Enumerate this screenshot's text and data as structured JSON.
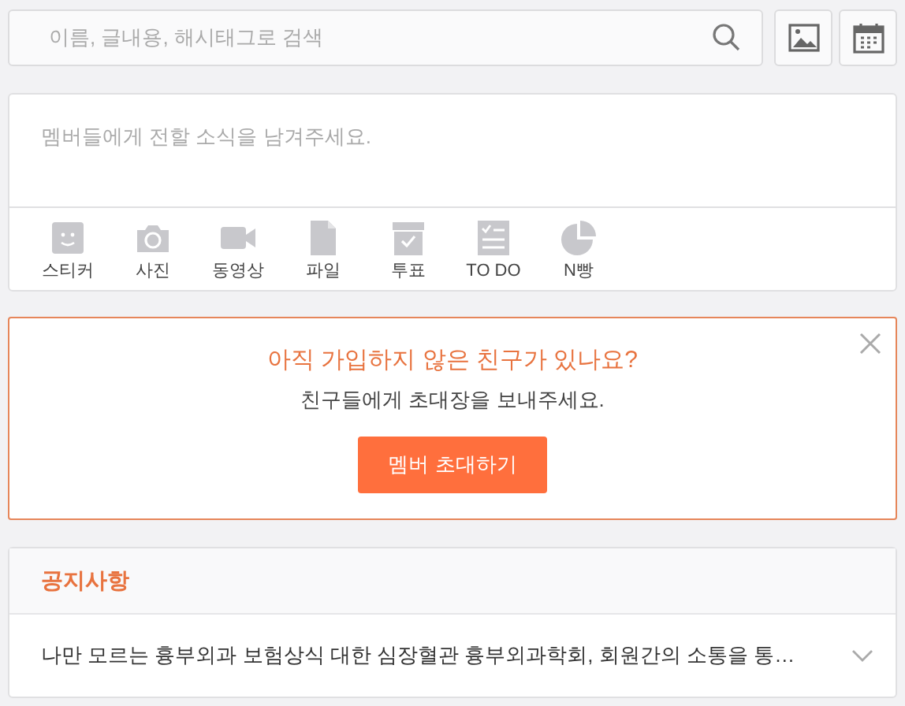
{
  "search": {
    "placeholder": "이름, 글내용, 해시태그로 검색"
  },
  "composer": {
    "placeholder": "멤버들에게 전할 소식을 남겨주세요.",
    "tools": [
      {
        "kind": "sticker",
        "label": "스티커"
      },
      {
        "kind": "photo",
        "label": "사진"
      },
      {
        "kind": "video",
        "label": "동영상"
      },
      {
        "kind": "file",
        "label": "파일"
      },
      {
        "kind": "vote",
        "label": "투표"
      },
      {
        "kind": "todo",
        "label": "TO DO"
      },
      {
        "kind": "split",
        "label": "N빵"
      }
    ]
  },
  "invite": {
    "title": "아직 가입하지 않은 친구가 있나요?",
    "subtitle": "친구들에게 초대장을 보내주세요.",
    "button": "멤버 초대하기"
  },
  "notice": {
    "title": "공지사항",
    "text": "나만 모르는 흉부외과 보험상식 대한 심장혈관 흉부외과학회, 회원간의 소통을 통…"
  }
}
